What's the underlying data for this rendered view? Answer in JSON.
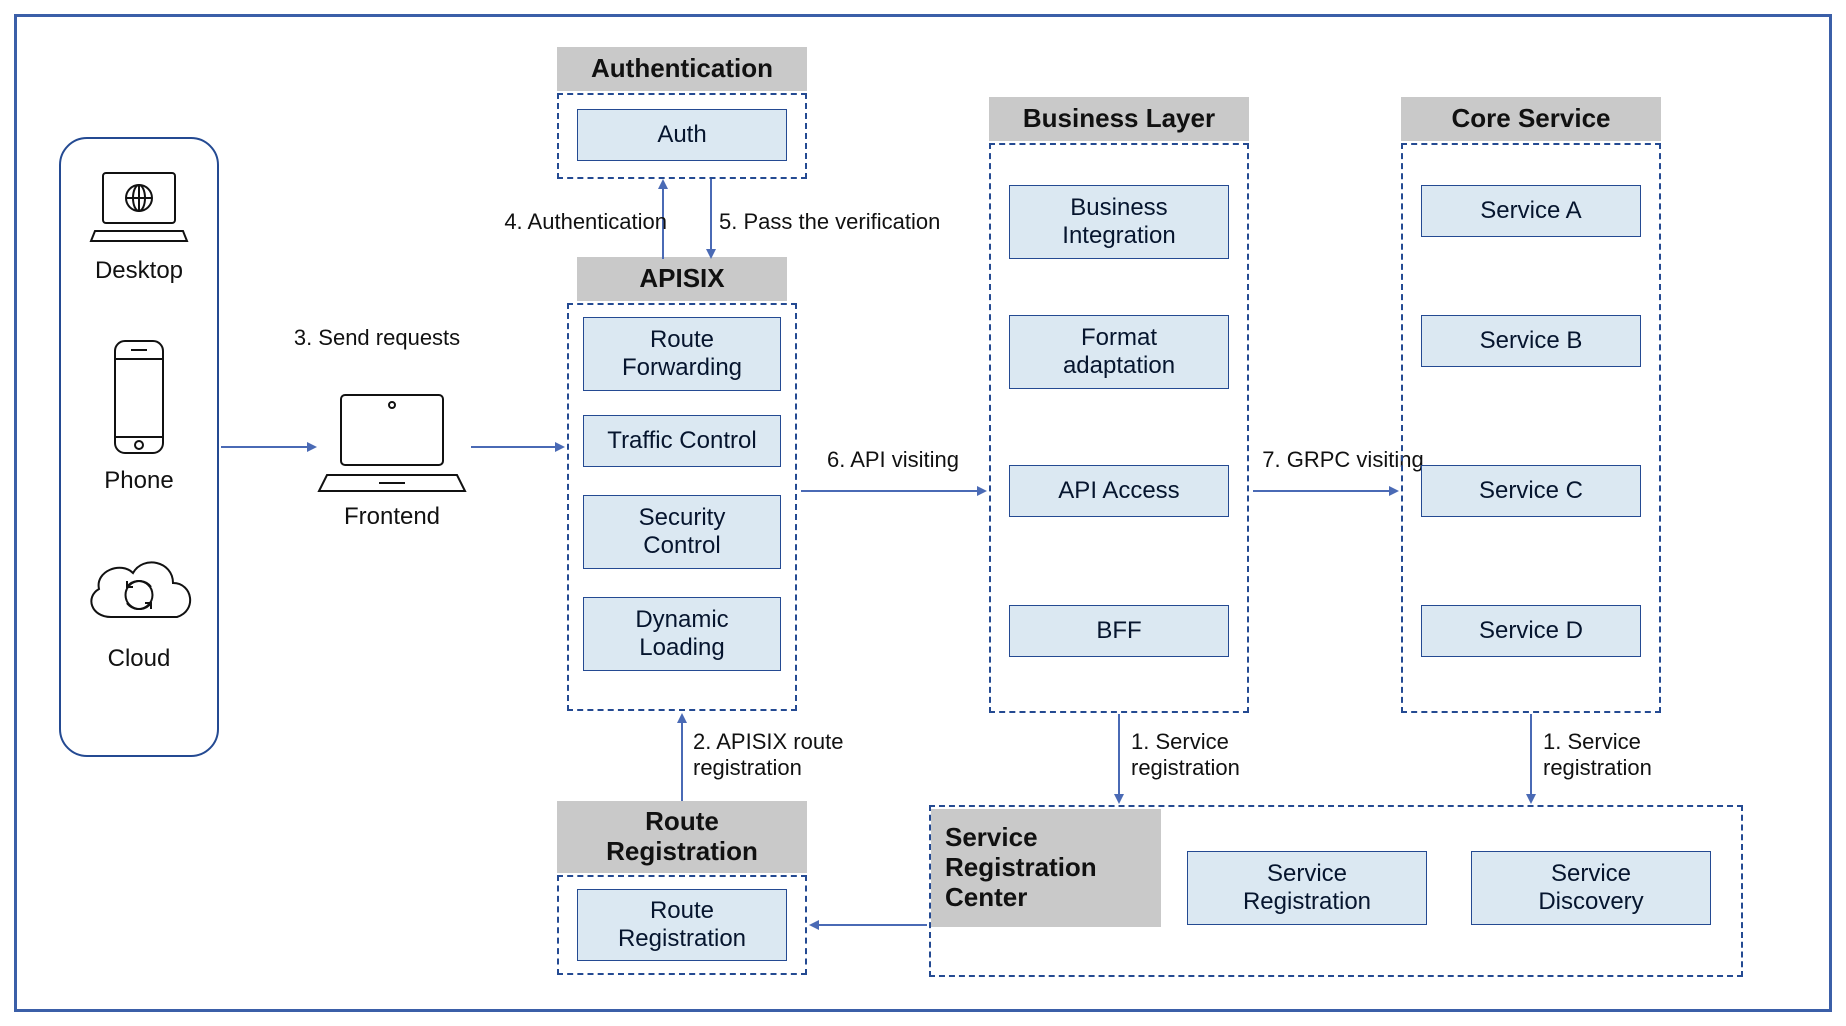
{
  "clients": {
    "desktop_label": "Desktop",
    "phone_label": "Phone",
    "cloud_label": "Cloud"
  },
  "frontend": {
    "label": "Frontend"
  },
  "arrows": {
    "a3": "3. Send requests",
    "a4": "4. Authentication",
    "a5": "5. Pass the verification",
    "a6": "6. API visiting",
    "a7": "7. GRPC visiting",
    "a2": "2. APISIX route\nregistration",
    "a1a": "1. Service\nregistration",
    "a1b": "1. Service\nregistration"
  },
  "authentication": {
    "title": "Authentication",
    "auth_box": "Auth"
  },
  "apisix": {
    "title": "APISIX",
    "route_forwarding": "Route\nForwarding",
    "traffic_control": "Traffic Control",
    "security_control": "Security\nControl",
    "dynamic_loading": "Dynamic\nLoading"
  },
  "business_layer": {
    "title": "Business Layer",
    "business_integration": "Business\nIntegration",
    "format_adaptation": "Format\nadaptation",
    "api_access": "API Access",
    "bff": "BFF"
  },
  "core_service": {
    "title": "Core Service",
    "service_a": "Service A",
    "service_b": "Service B",
    "service_c": "Service C",
    "service_d": "Service D"
  },
  "route_registration": {
    "title": "Route\nRegistration",
    "box": "Route\nRegistration"
  },
  "service_registration_center": {
    "title": "Service\nRegistration\nCenter",
    "service_registration": "Service\nRegistration",
    "service_discovery": "Service\nDiscovery"
  }
}
